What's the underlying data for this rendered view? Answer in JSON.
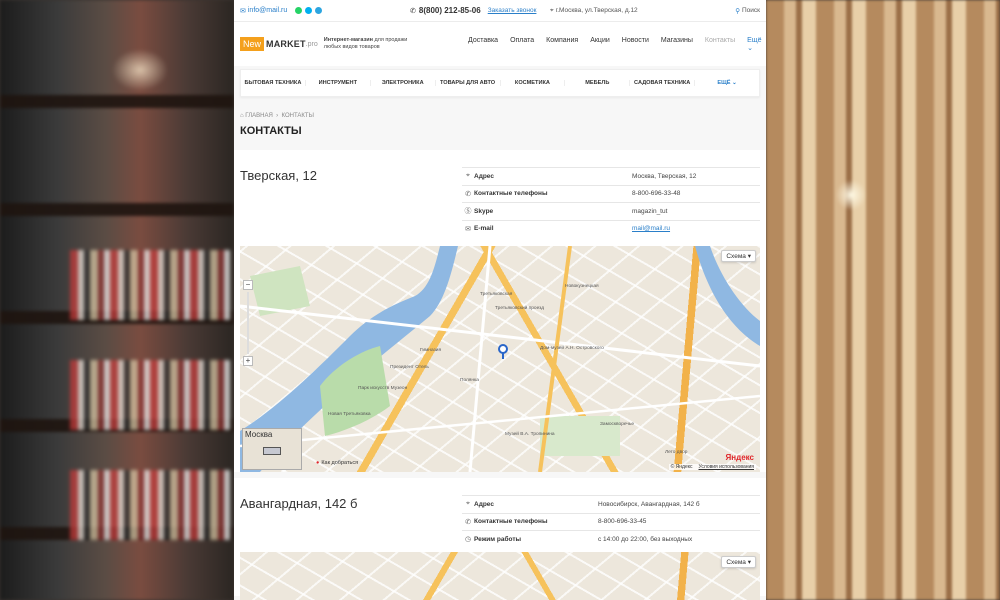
{
  "topbar": {
    "email": "info@mail.ru",
    "phone": "8(800) 212-85-06",
    "callback": "Заказать звонок",
    "address": "г.Москва, ул.Тверская, д.12",
    "search": "Поиск"
  },
  "header": {
    "logo_new": "New",
    "logo_market": "MARKET",
    "logo_pro": ".pro",
    "tagline_bold": "Интернет-магазин",
    "tagline_rest": " для продажи любых видов товаров",
    "nav": [
      "Доставка",
      "Оплата",
      "Компания",
      "Акции",
      "Новости",
      "Магазины",
      "Контакты",
      "Ещё"
    ]
  },
  "categories": [
    "Бытовая техника",
    "Инструмент",
    "Электроника",
    "Товары для авто",
    "Косметика",
    "Мебель",
    "Садовая техника",
    "Ещё"
  ],
  "breadcrumb": {
    "home": "Главная",
    "current": "Контакты"
  },
  "page_title": "КОНТАКТЫ",
  "store1": {
    "title": "Тверская, 12",
    "rows": [
      {
        "label": "Адрес",
        "value": "Москва, Тверская, 12"
      },
      {
        "label": "Контактные телефоны",
        "value": "8-800-696-33-48"
      },
      {
        "label": "Skype",
        "value": "magazin_tut"
      },
      {
        "label": "E-mail",
        "value": "mail@mail.ru"
      }
    ],
    "map": {
      "scheme": "Схема",
      "minimap": "Москва",
      "route": "Как добраться",
      "copyright": "© Яндекс",
      "terms": "Условия использования",
      "yandex": "Яндекс",
      "labels": [
        "Третьяковская",
        "Новокузнецкая",
        "Замоскворечье",
        "Полянка",
        "Парк искусств Музеон",
        "Президент Отель",
        "Новая Третьяковка",
        "Гимназия",
        "Дом-музей А.Н. Островского",
        "Музей В.А. Тропинина",
        "Лето двор",
        "Третьяковский проезд"
      ]
    }
  },
  "store2": {
    "title": "Авангардная, 142 б",
    "rows": [
      {
        "label": "Адрес",
        "value": "Новосибирск, Авангардная, 142 б"
      },
      {
        "label": "Контактные телефоны",
        "value": "8-800-696-33-45"
      },
      {
        "label": "Режим работы",
        "value": "с 14:00 до 22:00, без выходных"
      }
    ],
    "map": {
      "scheme": "Схема"
    }
  },
  "colors": {
    "accent": "#2a7fc9",
    "brand": "#f4a01c"
  }
}
